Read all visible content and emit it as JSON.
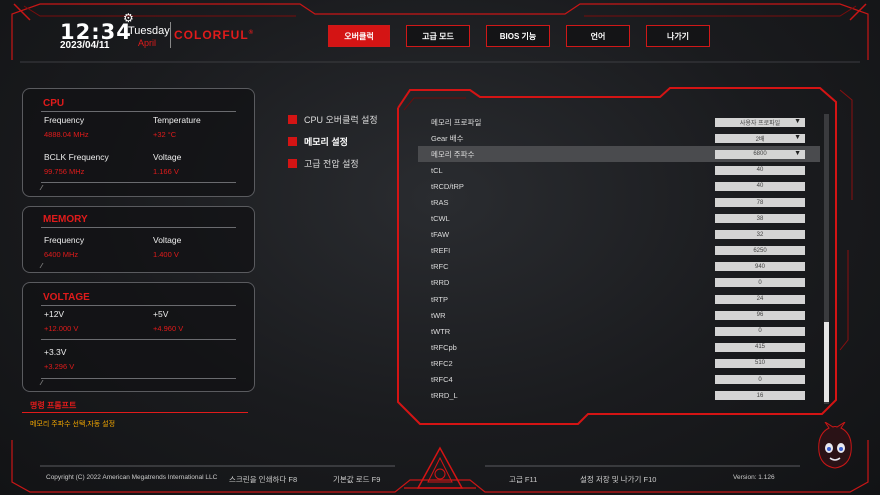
{
  "header": {
    "time": "12:34",
    "date": "2023/04/11",
    "day": "Tuesday",
    "month": "April",
    "brand": "COLORFUL",
    "brand_mark": "®"
  },
  "topnav": [
    {
      "label": "오버클럭",
      "active": true
    },
    {
      "label": "고급 모드",
      "active": false
    },
    {
      "label": "BIOS 기능",
      "active": false
    },
    {
      "label": "언어",
      "active": false
    },
    {
      "label": "나가기",
      "active": false
    }
  ],
  "cpu": {
    "title": "CPU",
    "frequency_label": "Frequency",
    "frequency": "4888.04 MHz",
    "temperature_label": "Temperature",
    "temperature": "+32 °C",
    "bclk_label": "BCLK Frequency",
    "bclk": "99.756 MHz",
    "voltage_label": "Voltage",
    "voltage": "1.166 V"
  },
  "memory": {
    "title": "MEMORY",
    "frequency_label": "Frequency",
    "frequency": "6400 MHz",
    "voltage_label": "Voltage",
    "voltage": "1.400 V"
  },
  "voltage": {
    "title": "VOLTAGE",
    "v12_label": "+12V",
    "v12": "+12.000 V",
    "v5_label": "+5V",
    "v5": "+4.960 V",
    "v33_label": "+3.3V",
    "v33": "+3.296 V"
  },
  "hint": {
    "title": "명령 프롬프트",
    "text": "메모리 주파수 선택,자동 설정"
  },
  "submenu": [
    {
      "label": "CPU 오버클럭 설정",
      "active": false
    },
    {
      "label": "메모리 설정",
      "active": true
    },
    {
      "label": "고급 전압 설정",
      "active": false
    }
  ],
  "settings": [
    {
      "label": "메모리 프로파일",
      "value": "사용자 프로파일",
      "type": "dropdown"
    },
    {
      "label": "Gear 배수",
      "value": "2배",
      "type": "dropdown"
    },
    {
      "label": "메모리 주파수",
      "value": "6800",
      "type": "dropdown",
      "selected": true
    },
    {
      "label": "tCL",
      "value": "40",
      "type": "value"
    },
    {
      "label": "tRCD/tRP",
      "value": "40",
      "type": "value"
    },
    {
      "label": "tRAS",
      "value": "78",
      "type": "value"
    },
    {
      "label": "tCWL",
      "value": "38",
      "type": "value"
    },
    {
      "label": "tFAW",
      "value": "32",
      "type": "value"
    },
    {
      "label": "tREFI",
      "value": "6250",
      "type": "value"
    },
    {
      "label": "tRFC",
      "value": "940",
      "type": "value"
    },
    {
      "label": "tRRD",
      "value": "0",
      "type": "value"
    },
    {
      "label": "tRTP",
      "value": "24",
      "type": "value"
    },
    {
      "label": "tWR",
      "value": "96",
      "type": "value"
    },
    {
      "label": "tWTR",
      "value": "0",
      "type": "value"
    },
    {
      "label": "tRFCpb",
      "value": "415",
      "type": "value"
    },
    {
      "label": "tRFC2",
      "value": "510",
      "type": "value"
    },
    {
      "label": "tRFC4",
      "value": "0",
      "type": "value"
    },
    {
      "label": "tRRD_L",
      "value": "16",
      "type": "value"
    }
  ],
  "footer": {
    "copyright": "Copyright (C) 2022 American Megatrends International LLC",
    "screenshot": "스크린을 인쇄하다 F8",
    "defaults": "기본값 로드 F9",
    "advanced": "고급 F11",
    "save_exit": "설정 저장 및 나가기 F10",
    "version": "Version: 1.126"
  },
  "colors": {
    "accent": "#e01b1b",
    "panel_border": "#5a5b5f",
    "background": "#1f2023"
  }
}
